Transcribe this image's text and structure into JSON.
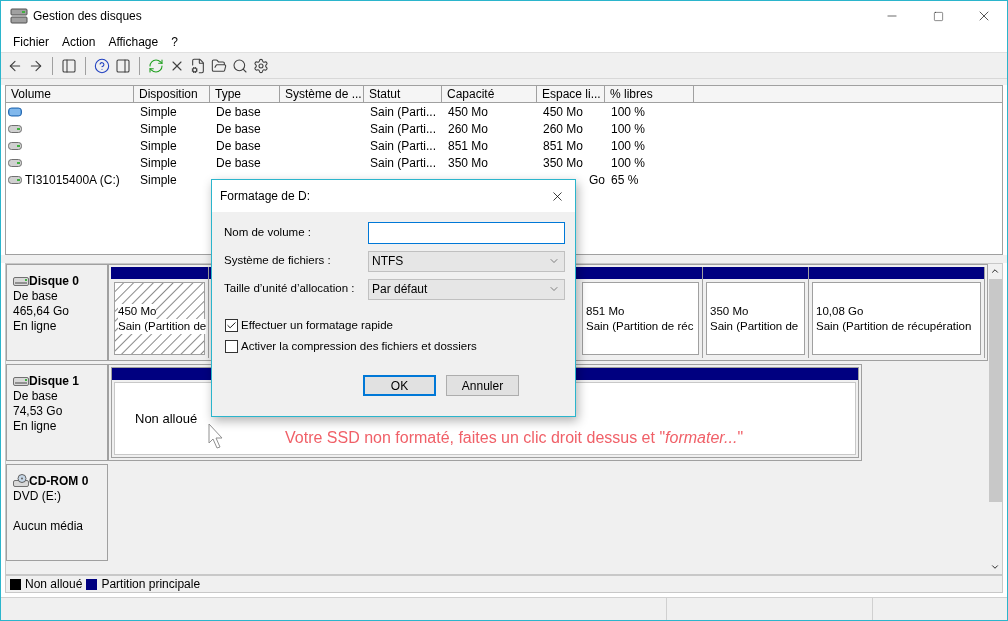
{
  "window": {
    "title": "Gestion des disques"
  },
  "menu": [
    {
      "label": "Fichier"
    },
    {
      "label": "Action"
    },
    {
      "label": "Affichage"
    },
    {
      "label": "?"
    }
  ],
  "volumes": {
    "columns": [
      "Volume",
      "Disposition",
      "Type",
      "Système de ...",
      "Statut",
      "Capacité",
      "Espace li...",
      "% libres"
    ],
    "rows": [
      {
        "kind": "striped",
        "disposition": "Simple",
        "type": "De base",
        "statut": "Sain (Parti...",
        "capacite": "450 Mo",
        "espace": "450 Mo",
        "libres": "100 %"
      },
      {
        "kind": "plain",
        "disposition": "Simple",
        "type": "De base",
        "statut": "Sain (Parti...",
        "capacite": "260 Mo",
        "espace": "260 Mo",
        "libres": "100 %"
      },
      {
        "kind": "plain",
        "disposition": "Simple",
        "type": "De base",
        "statut": "Sain (Parti...",
        "capacite": "851 Mo",
        "espace": "851 Mo",
        "libres": "100 %"
      },
      {
        "kind": "plain",
        "disposition": "Simple",
        "type": "De base",
        "statut": "Sain (Parti...",
        "capacite": "350 Mo",
        "espace": "350 Mo",
        "libres": "100 %"
      },
      {
        "kind": "plain",
        "volume": "TI31015400A (C:)",
        "disposition": "Simple",
        "espace": "Go",
        "libres": "65 %"
      }
    ]
  },
  "disks": [
    {
      "kind": "disk",
      "name": "Disque 0",
      "lines": [
        "De base",
        "465,64 Go",
        "En ligne"
      ],
      "partitions": [
        {
          "kind": "primary",
          "size": "450 Mo",
          "status": "Sain (Partition de",
          "selected": true
        },
        {
          "kind": "primary",
          "size": "851 Mo",
          "status": "Sain (Partition de réc",
          "selected": false
        },
        {
          "kind": "primary",
          "size": "350 Mo",
          "status": "Sain (Partition de",
          "selected": false
        },
        {
          "kind": "primary",
          "size": "10,08 Go",
          "status": "Sain (Partition de récupération",
          "selected": false
        }
      ]
    },
    {
      "kind": "disk",
      "name": "Disque 1",
      "lines": [
        "De base",
        "74,53 Go",
        "En ligne"
      ],
      "partitions": [
        {
          "kind": "unallocated",
          "label": "Non alloué",
          "selected": false
        }
      ]
    },
    {
      "kind": "cdrom",
      "name": "CD-ROM 0",
      "lines": [
        "DVD (E:)",
        "Aucun média"
      ]
    }
  ],
  "legend": [
    {
      "label": "Non alloué",
      "color": "#000000"
    },
    {
      "label": "Partition principale",
      "color": "#000080"
    }
  ],
  "annotation": "Votre SSD non formaté, faites un clic droit dessus et \"*formater...*\"",
  "dialog": {
    "title": "Formatage de D:",
    "fields": [
      {
        "kind": "text",
        "label": "Nom de volume :"
      },
      {
        "kind": "select",
        "label": "Système de fichiers :",
        "value": "NTFS"
      },
      {
        "kind": "select",
        "label": "Taille d’unité d’allocation :",
        "value": "Par défaut"
      }
    ],
    "checkboxes": [
      {
        "label": "Effectuer un formatage rapide",
        "checked": true
      },
      {
        "label": "Activer la compression des fichiers et dossiers",
        "checked": false
      }
    ],
    "buttons": [
      {
        "label": "OK",
        "default": true
      },
      {
        "label": "Annuler",
        "default": false
      }
    ]
  }
}
